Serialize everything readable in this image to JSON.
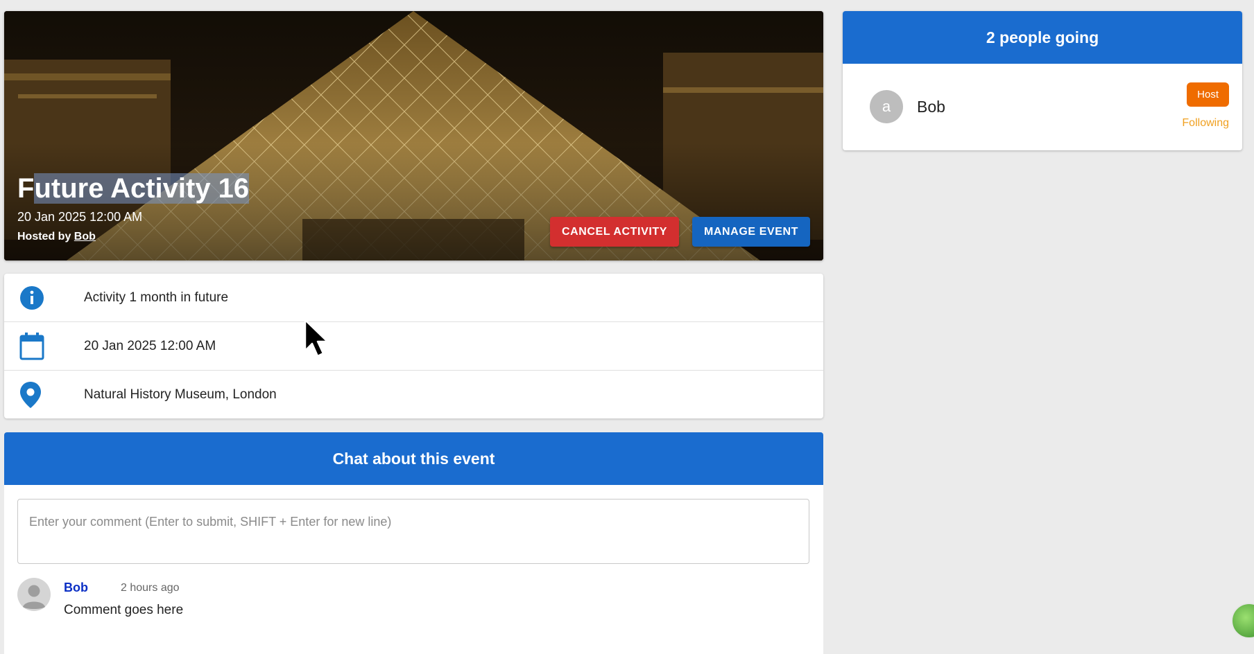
{
  "hero": {
    "title_prefix": "F",
    "title_selected": "uture Activity 16",
    "date": "20 Jan 2025 12:00 AM",
    "hosted_by_label": "Hosted by",
    "host_name": "Bob",
    "cancel_label": "CANCEL ACTIVITY",
    "manage_label": "MANAGE EVENT"
  },
  "details": {
    "description": "Activity 1 month in future",
    "date": "20 Jan 2025 12:00 AM",
    "venue": "Natural History Museum, London"
  },
  "chat": {
    "header": "Chat about this event",
    "input_placeholder": "Enter your comment (Enter to submit, SHIFT + Enter for new line)",
    "comments": [
      {
        "author": "Bob",
        "time": "2 hours ago",
        "body": "Comment goes here"
      }
    ]
  },
  "attendees": {
    "header": "2 people going",
    "list": [
      {
        "initial": "a",
        "name": "Bob",
        "badge": "Host",
        "status": "Following"
      }
    ]
  },
  "colors": {
    "primary": "#1a6ccf",
    "danger": "#d32f2f",
    "host_badge": "#ef6c00",
    "following": "#f0a020",
    "comment_author": "#0b2fc5"
  },
  "icons": [
    "info-icon",
    "calendar-icon",
    "location-pin-icon",
    "avatar-placeholder-icon",
    "cursor-icon"
  ]
}
